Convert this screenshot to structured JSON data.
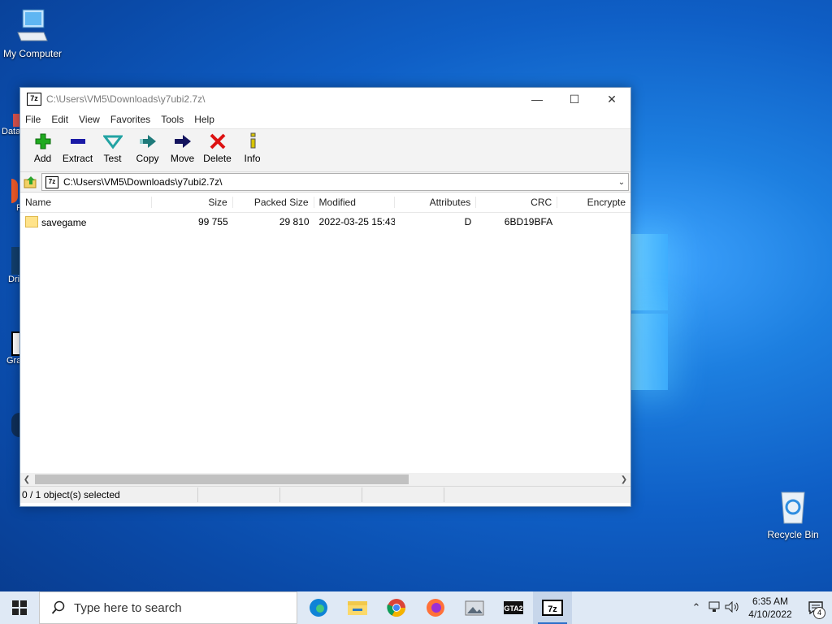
{
  "desktop": {
    "my_computer_label": "My Computer",
    "recycle_bin_label": "Recycle Bin",
    "partial_labels": [
      "Data",
      "F",
      "Dri",
      "Gra",
      "A"
    ]
  },
  "window": {
    "title": "C:\\Users\\VM5\\Downloads\\y7ubi2.7z\\",
    "app_icon_text": "7z",
    "controls": {
      "minimize": "—",
      "maximize": "☐",
      "close": "✕"
    },
    "menu": [
      "File",
      "Edit",
      "View",
      "Favorites",
      "Tools",
      "Help"
    ],
    "toolbar": [
      {
        "label": "Add",
        "icon": "add-icon",
        "color": "#1faa1f"
      },
      {
        "label": "Extract",
        "icon": "extract-icon",
        "color": "#1a1aa6"
      },
      {
        "label": "Test",
        "icon": "test-icon",
        "color": "#22a3a3"
      },
      {
        "label": "Copy",
        "icon": "copy-icon",
        "color": "#1e7a7a"
      },
      {
        "label": "Move",
        "icon": "move-icon",
        "color": "#14145e"
      },
      {
        "label": "Delete",
        "icon": "delete-icon",
        "color": "#d11"
      },
      {
        "label": "Info",
        "icon": "info-icon",
        "color": "#d8c400"
      }
    ],
    "address": "C:\\Users\\VM5\\Downloads\\y7ubi2.7z\\",
    "columns": [
      "Name",
      "Size",
      "Packed Size",
      "Modified",
      "Attributes",
      "CRC",
      "Encrypte"
    ],
    "rows": [
      {
        "name": "savegame",
        "size": "99 755",
        "packed_size": "29 810",
        "modified": "2022-03-25 15:43",
        "attributes": "D",
        "crc": "6BD19BFA",
        "encrypted": ""
      }
    ],
    "status": "0 / 1 object(s) selected"
  },
  "taskbar": {
    "search_placeholder": "Type here to search",
    "apps": [
      "edge-icon",
      "file-explorer-icon",
      "chrome-icon",
      "firefox-icon",
      "photos-icon",
      "gta2-icon",
      "7zip-icon"
    ],
    "gta_text": "GTA2",
    "sevenzip_text": "7z",
    "time": "6:35 AM",
    "date": "4/10/2022",
    "notification_count": "4"
  },
  "colors": {
    "accent": "#2c6fc9",
    "desktop_bg": "#0f5fc6"
  }
}
